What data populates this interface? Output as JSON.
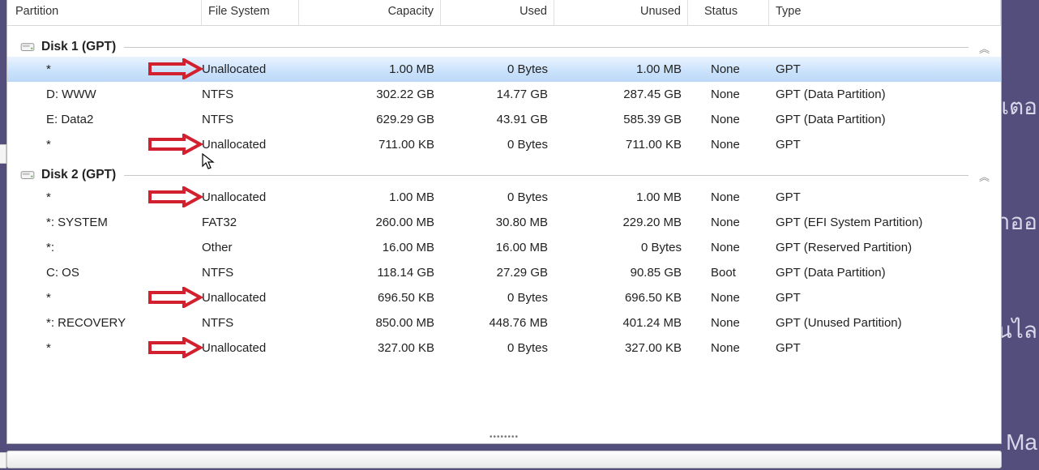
{
  "columns": {
    "partition": "Partition",
    "fs": "File System",
    "capacity": "Capacity",
    "used": "Used",
    "unused": "Unused",
    "status": "Status",
    "type": "Type"
  },
  "disks": [
    {
      "title": "Disk 1 (GPT)",
      "rows": [
        {
          "partition": "*",
          "fs": "Unallocated",
          "capacity": "1.00 MB",
          "used": "0 Bytes",
          "unused": "1.00 MB",
          "status": "None",
          "type": "GPT",
          "arrow": true,
          "selected": true
        },
        {
          "partition": "D: WWW",
          "fs": "NTFS",
          "capacity": "302.22 GB",
          "used": "14.77 GB",
          "unused": "287.45 GB",
          "status": "None",
          "type": "GPT (Data Partition)",
          "arrow": false
        },
        {
          "partition": "E: Data2",
          "fs": "NTFS",
          "capacity": "629.29 GB",
          "used": "43.91 GB",
          "unused": "585.39 GB",
          "status": "None",
          "type": "GPT (Data Partition)",
          "arrow": false
        },
        {
          "partition": "*",
          "fs": "Unallocated",
          "capacity": "711.00 KB",
          "used": "0 Bytes",
          "unused": "711.00 KB",
          "status": "None",
          "type": "GPT",
          "arrow": true
        }
      ]
    },
    {
      "title": "Disk 2 (GPT)",
      "rows": [
        {
          "partition": "*",
          "fs": "Unallocated",
          "capacity": "1.00 MB",
          "used": "0 Bytes",
          "unused": "1.00 MB",
          "status": "None",
          "type": "GPT",
          "arrow": true
        },
        {
          "partition": "*: SYSTEM",
          "fs": "FAT32",
          "capacity": "260.00 MB",
          "used": "30.80 MB",
          "unused": "229.20 MB",
          "status": "None",
          "type": "GPT (EFI System Partition)",
          "arrow": false
        },
        {
          "partition": "*:",
          "fs": "Other",
          "capacity": "16.00 MB",
          "used": "16.00 MB",
          "unused": "0 Bytes",
          "status": "None",
          "type": "GPT (Reserved Partition)",
          "arrow": false
        },
        {
          "partition": "C: OS",
          "fs": "NTFS",
          "capacity": "118.14 GB",
          "used": "27.29 GB",
          "unused": "90.85 GB",
          "status": "Boot",
          "type": "GPT (Data Partition)",
          "arrow": false
        },
        {
          "partition": "*",
          "fs": "Unallocated",
          "capacity": "696.50 KB",
          "used": "0 Bytes",
          "unused": "696.50 KB",
          "status": "None",
          "type": "GPT",
          "arrow": true
        },
        {
          "partition": "*: RECOVERY",
          "fs": "NTFS",
          "capacity": "850.00 MB",
          "used": "448.76 MB",
          "unused": "401.24 MB",
          "status": "None",
          "type": "GPT (Unused Partition)",
          "arrow": false
        },
        {
          "partition": "*",
          "fs": "Unallocated",
          "capacity": "327.00 KB",
          "used": "0 Bytes",
          "unused": "327.00 KB",
          "status": "None",
          "type": "GPT",
          "arrow": true
        }
      ]
    }
  ],
  "bgText": [
    "เตอ",
    "าออ",
    "นไล",
    "Ma"
  ]
}
